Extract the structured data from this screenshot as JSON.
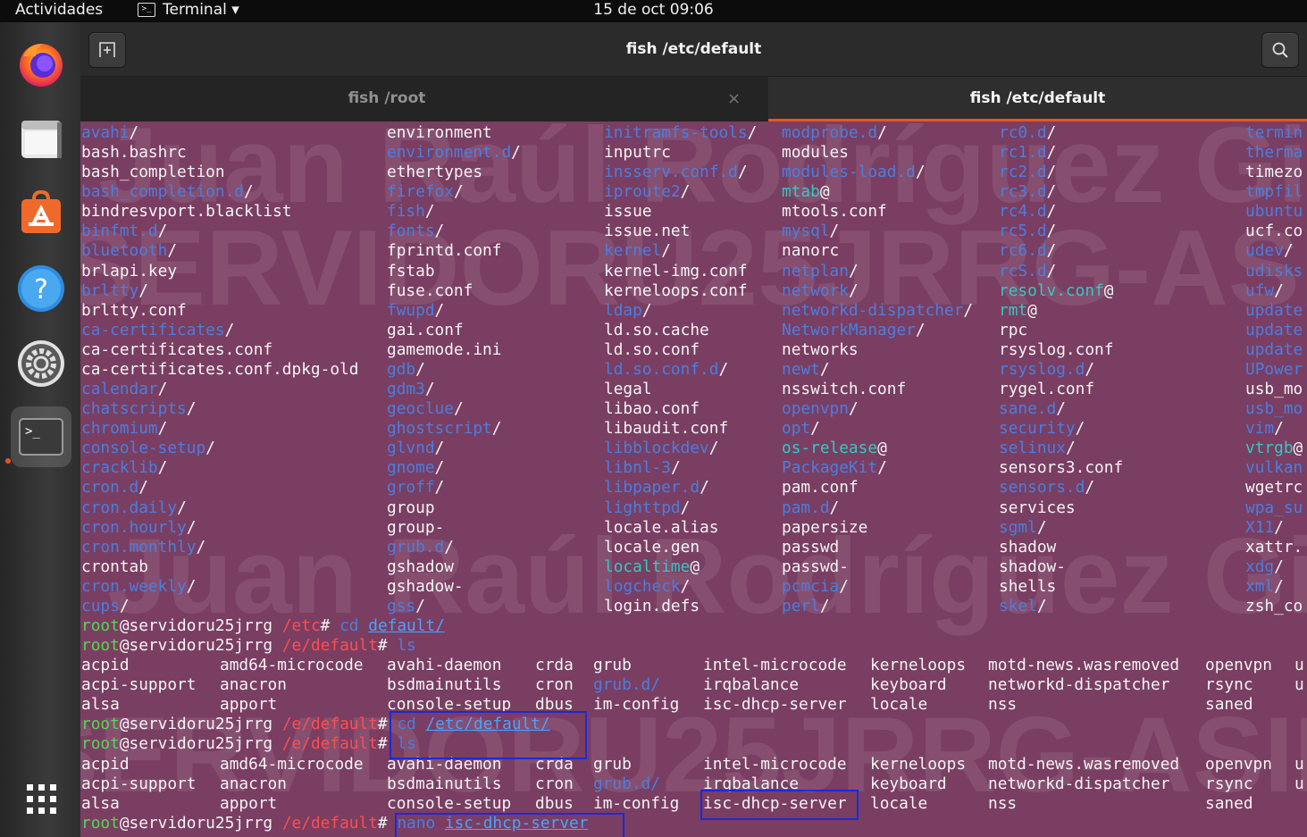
{
  "topbar": {
    "activities": "Actividades",
    "app_menu": "Terminal ▾",
    "clock": "15 de oct  09:06"
  },
  "dock": {
    "apps": [
      "firefox-icon",
      "files-icon",
      "software-icon",
      "help-icon",
      "settings-icon",
      "terminal-icon",
      "apps-grid-icon"
    ]
  },
  "window": {
    "title": "fish /etc/default"
  },
  "tabs": [
    {
      "label": "fish /root",
      "active": false
    },
    {
      "label": "fish /etc/default",
      "active": true
    }
  ],
  "tab_close": "×",
  "colors": {
    "dir": "#4a7ee0",
    "link": "#33c9c2",
    "prompt_path": "#ff4d4d",
    "exec": "#4fdb4f",
    "bg": "#7a3e62"
  },
  "watermark": [
    "Juan Raúl Rodríguez Gil",
    "SERVIDORU25JRRG-ASIR"
  ],
  "listing": {
    "col0": [
      [
        "avahi",
        "d",
        "/"
      ],
      [
        "bash.bashrc",
        "",
        ""
      ],
      [
        "bash_completion",
        "",
        ""
      ],
      [
        "bash_completion.d",
        "d",
        "/"
      ],
      [
        "bindresvport.blacklist",
        "",
        ""
      ],
      [
        "binfmt.d",
        "d",
        "/"
      ],
      [
        "bluetooth",
        "d",
        "/"
      ],
      [
        "brlapi.key",
        "",
        ""
      ],
      [
        "brltty",
        "d",
        "/"
      ],
      [
        "brltty.conf",
        "",
        ""
      ],
      [
        "ca-certificates",
        "d",
        "/"
      ],
      [
        "ca-certificates.conf",
        "",
        ""
      ],
      [
        "ca-certificates.conf.dpkg-old",
        "",
        ""
      ],
      [
        "calendar",
        "d",
        "/"
      ],
      [
        "chatscripts",
        "d",
        "/"
      ],
      [
        "chromium",
        "d",
        "/"
      ],
      [
        "console-setup",
        "d",
        "/"
      ],
      [
        "cracklib",
        "d",
        "/"
      ],
      [
        "cron.d",
        "d",
        "/"
      ],
      [
        "cron.daily",
        "d",
        "/"
      ],
      [
        "cron.hourly",
        "d",
        "/"
      ],
      [
        "cron.monthly",
        "d",
        "/"
      ],
      [
        "crontab",
        "",
        ""
      ],
      [
        "cron.weekly",
        "d",
        "/"
      ],
      [
        "cups",
        "d",
        "/"
      ]
    ],
    "col1": [
      [
        "environment",
        "",
        ""
      ],
      [
        "environment.d",
        "d",
        "/"
      ],
      [
        "ethertypes",
        "",
        ""
      ],
      [
        "firefox",
        "d",
        "/"
      ],
      [
        "fish",
        "d",
        "/"
      ],
      [
        "fonts",
        "d",
        "/"
      ],
      [
        "fprintd.conf",
        "",
        ""
      ],
      [
        "fstab",
        "",
        ""
      ],
      [
        "fuse.conf",
        "",
        ""
      ],
      [
        "fwupd",
        "d",
        "/"
      ],
      [
        "gai.conf",
        "",
        ""
      ],
      [
        "gamemode.ini",
        "",
        ""
      ],
      [
        "gdb",
        "d",
        "/"
      ],
      [
        "gdm3",
        "d",
        "/"
      ],
      [
        "geoclue",
        "d",
        "/"
      ],
      [
        "ghostscript",
        "d",
        "/"
      ],
      [
        "glvnd",
        "d",
        "/"
      ],
      [
        "gnome",
        "d",
        "/"
      ],
      [
        "groff",
        "d",
        "/"
      ],
      [
        "group",
        "",
        ""
      ],
      [
        "group-",
        "",
        ""
      ],
      [
        "grub.d",
        "d",
        "/"
      ],
      [
        "gshadow",
        "",
        ""
      ],
      [
        "gshadow-",
        "",
        ""
      ],
      [
        "gss",
        "d",
        "/"
      ]
    ],
    "col2": [
      [
        "initramfs-tools",
        "d",
        "/"
      ],
      [
        "inputrc",
        "",
        ""
      ],
      [
        "insserv.conf.d",
        "d",
        "/"
      ],
      [
        "iproute2",
        "d",
        "/"
      ],
      [
        "issue",
        "",
        ""
      ],
      [
        "issue.net",
        "",
        ""
      ],
      [
        "kernel",
        "d",
        "/"
      ],
      [
        "kernel-img.conf",
        "",
        ""
      ],
      [
        "kerneloops.conf",
        "",
        ""
      ],
      [
        "ldap",
        "d",
        "/"
      ],
      [
        "ld.so.cache",
        "",
        ""
      ],
      [
        "ld.so.conf",
        "",
        ""
      ],
      [
        "ld.so.conf.d",
        "d",
        "/"
      ],
      [
        "legal",
        "",
        ""
      ],
      [
        "libao.conf",
        "",
        ""
      ],
      [
        "libaudit.conf",
        "",
        ""
      ],
      [
        "libblockdev",
        "d",
        "/"
      ],
      [
        "libnl-3",
        "d",
        "/"
      ],
      [
        "libpaper.d",
        "d",
        "/"
      ],
      [
        "lighttpd",
        "d",
        "/"
      ],
      [
        "locale.alias",
        "",
        ""
      ],
      [
        "locale.gen",
        "",
        ""
      ],
      [
        "localtime",
        "l",
        "@"
      ],
      [
        "logcheck",
        "d",
        "/"
      ],
      [
        "login.defs",
        "",
        ""
      ]
    ],
    "col3": [
      [
        "modprobe.d",
        "d",
        "/"
      ],
      [
        "modules",
        "",
        ""
      ],
      [
        "modules-load.d",
        "d",
        "/"
      ],
      [
        "mtab",
        "l",
        "@"
      ],
      [
        "mtools.conf",
        "",
        ""
      ],
      [
        "mysql",
        "d",
        "/"
      ],
      [
        "nanorc",
        "",
        ""
      ],
      [
        "netplan",
        "d",
        "/"
      ],
      [
        "network",
        "d",
        "/"
      ],
      [
        "networkd-dispatcher",
        "d",
        "/"
      ],
      [
        "NetworkManager",
        "d",
        "/"
      ],
      [
        "networks",
        "",
        ""
      ],
      [
        "newt",
        "d",
        "/"
      ],
      [
        "nsswitch.conf",
        "",
        ""
      ],
      [
        "openvpn",
        "d",
        "/"
      ],
      [
        "opt",
        "d",
        "/"
      ],
      [
        "os-release",
        "l",
        "@"
      ],
      [
        "PackageKit",
        "d",
        "/"
      ],
      [
        "pam.conf",
        "",
        ""
      ],
      [
        "pam.d",
        "d",
        "/"
      ],
      [
        "papersize",
        "",
        ""
      ],
      [
        "passwd",
        "",
        ""
      ],
      [
        "passwd-",
        "",
        ""
      ],
      [
        "pcmcia",
        "d",
        "/"
      ],
      [
        "perl",
        "d",
        "/"
      ]
    ],
    "col4": [
      [
        "rc0.d",
        "d",
        "/"
      ],
      [
        "rc1.d",
        "d",
        "/"
      ],
      [
        "rc2.d",
        "d",
        "/"
      ],
      [
        "rc3.d",
        "d",
        "/"
      ],
      [
        "rc4.d",
        "d",
        "/"
      ],
      [
        "rc5.d",
        "d",
        "/"
      ],
      [
        "rc6.d",
        "d",
        "/"
      ],
      [
        "rcS.d",
        "d",
        "/"
      ],
      [
        "resolv.conf",
        "l",
        "@"
      ],
      [
        "rmt",
        "l",
        "@"
      ],
      [
        "rpc",
        "",
        ""
      ],
      [
        "rsyslog.conf",
        "",
        ""
      ],
      [
        "rsyslog.d",
        "d",
        "/"
      ],
      [
        "rygel.conf",
        "",
        ""
      ],
      [
        "sane.d",
        "d",
        "/"
      ],
      [
        "security",
        "d",
        "/"
      ],
      [
        "selinux",
        "d",
        "/"
      ],
      [
        "sensors3.conf",
        "",
        ""
      ],
      [
        "sensors.d",
        "d",
        "/"
      ],
      [
        "services",
        "",
        ""
      ],
      [
        "sgml",
        "d",
        "/"
      ],
      [
        "shadow",
        "",
        ""
      ],
      [
        "shadow-",
        "",
        ""
      ],
      [
        "shells",
        "",
        ""
      ],
      [
        "skel",
        "d",
        "/"
      ]
    ],
    "col5": [
      [
        "termin",
        "d",
        ""
      ],
      [
        "therma",
        "d",
        ""
      ],
      [
        "timezo",
        "",
        ""
      ],
      [
        "tmpfil",
        "d",
        ""
      ],
      [
        "ubuntu",
        "d",
        ""
      ],
      [
        "ucf.co",
        "",
        ""
      ],
      [
        "udev",
        "d",
        "/"
      ],
      [
        "udisks",
        "d",
        ""
      ],
      [
        "ufw",
        "d",
        "/"
      ],
      [
        "update",
        "d",
        ""
      ],
      [
        "update",
        "d",
        ""
      ],
      [
        "update",
        "d",
        ""
      ],
      [
        "UPower",
        "d",
        ""
      ],
      [
        "usb_mo",
        "",
        ""
      ],
      [
        "usb_mo",
        "d",
        ""
      ],
      [
        "vim",
        "d",
        "/"
      ],
      [
        "vtrgb",
        "l",
        "@"
      ],
      [
        "vulkan",
        "d",
        ""
      ],
      [
        "wgetrc",
        "",
        ""
      ],
      [
        "wpa_su",
        "d",
        ""
      ],
      [
        "X11",
        "d",
        "/"
      ],
      [
        "xattr.",
        "",
        ""
      ],
      [
        "xdg",
        "d",
        "/"
      ],
      [
        "xml",
        "d",
        "/"
      ],
      [
        "zsh_co",
        "",
        ""
      ]
    ]
  },
  "session": [
    {
      "type": "prompt",
      "user": "root",
      "host": "@servidoru25jrrg",
      "path": "/etc",
      "sep": "#",
      "cmd": "cd",
      "arg": "default/"
    },
    {
      "type": "prompt",
      "user": "root",
      "host": "@servidoru25jrrg",
      "path": "/e/default",
      "sep": "#",
      "cmd": "ls",
      "arg": ""
    },
    {
      "type": "ls",
      "rows": [
        [
          "acpid",
          "amd64-microcode",
          "avahi-daemon",
          "crda",
          "grub",
          "intel-microcode",
          "kerneloops",
          "motd-news.wasremoved",
          "openvpn",
          "u"
        ],
        [
          "acpi-support",
          "anacron",
          "bsdmainutils",
          "cron",
          "grub.d/",
          "irqbalance",
          "keyboard",
          "networkd-dispatcher",
          "rsync",
          "u"
        ],
        [
          "alsa",
          "apport",
          "console-setup",
          "dbus",
          "im-config",
          "isc-dhcp-server",
          "locale",
          "nss",
          "saned",
          ""
        ]
      ]
    },
    {
      "type": "prompt",
      "user": "root",
      "host": "@servidoru25jrrg",
      "path": "/e/default",
      "sep": "#",
      "cmd": "cd",
      "arg": "/etc/default/"
    },
    {
      "type": "prompt",
      "user": "root",
      "host": "@servidoru25jrrg",
      "path": "/e/default",
      "sep": "#",
      "cmd": "ls",
      "arg": ""
    },
    {
      "type": "ls",
      "rows": [
        [
          "acpid",
          "amd64-microcode",
          "avahi-daemon",
          "crda",
          "grub",
          "intel-microcode",
          "kerneloops",
          "motd-news.wasremoved",
          "openvpn",
          "u"
        ],
        [
          "acpi-support",
          "anacron",
          "bsdmainutils",
          "cron",
          "grub.d/",
          "irqbalance",
          "keyboard",
          "networkd-dispatcher",
          "rsync",
          "u"
        ],
        [
          "alsa",
          "apport",
          "console-setup",
          "dbus",
          "im-config",
          "isc-dhcp-server",
          "locale",
          "nss",
          "saned",
          ""
        ]
      ]
    },
    {
      "type": "prompt",
      "user": "root",
      "host": "@servidoru25jrrg",
      "path": "/e/default",
      "sep": "#",
      "cmd": "nano",
      "arg": "isc-dhcp-server"
    }
  ]
}
